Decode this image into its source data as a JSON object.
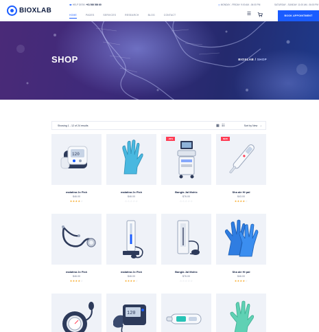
{
  "header": {
    "logo": "BIOXLAB",
    "help_label": "HELP DESK:",
    "help_phone": "+01 500 500 60",
    "address": "MONDAY - FRIDAY: 9:00 AM - 06:00 PM",
    "hours": "SATURDAY - SUNDAY: 11:00 AM - 06:00 PM",
    "nav": [
      "HOME",
      "PAGES",
      "SERVICES",
      "RESEARCH",
      "BLOG",
      "CONTACT"
    ],
    "appointment_label": "BOOK APPOINTMENT"
  },
  "hero": {
    "title": "SHOP",
    "breadcrumb_home": "BIOXLAB",
    "breadcrumb_sep": " / ",
    "breadcrumb_current": "SHOP"
  },
  "toolbar": {
    "result_text": "Showing 1 - 12 of 24 results",
    "sort_label": "Sort by New"
  },
  "colors": {
    "accent": "#1a5cff",
    "badge": "#ff3b53",
    "star": "#f5a623"
  },
  "products": [
    {
      "name": "malatina 2x Fish",
      "price": "$46.00",
      "rating": 4,
      "badge": "",
      "icon": "blood-pressure-monitor-icon"
    },
    {
      "name": "malatina 2x Fish",
      "price": "$46.00",
      "rating": 0,
      "badge": "",
      "icon": "medical-glove-icon"
    },
    {
      "name": "Bangla Jal Mohic",
      "price": "$76.00",
      "rating": 0,
      "badge": "-30%",
      "icon": "ultrasound-machine-icon"
    },
    {
      "name": "Sha ale Hi pal",
      "price": "$43.00",
      "rating": 4,
      "badge": "NEW",
      "icon": "thermometer-icon"
    },
    {
      "name": "malatina 2x Fish",
      "price": "$46.00",
      "rating": 4,
      "badge": "",
      "icon": "stethoscope-icon"
    },
    {
      "name": "malatina 2x Fish",
      "price": "$46.00",
      "rating": 4,
      "badge": "",
      "icon": "sphygmomanometer-icon"
    },
    {
      "name": "Bangla Jal Mohic",
      "price": "$76.00",
      "rating": 0,
      "badge": "",
      "icon": "wall-bp-monitor-icon"
    },
    {
      "name": "Sha ale Hi pal",
      "price": "$46.00",
      "rating": 4,
      "badge": "",
      "icon": "blue-gloves-icon"
    },
    {
      "name": "",
      "price": "",
      "rating": 0,
      "badge": "",
      "icon": "bp-cuff-icon"
    },
    {
      "name": "",
      "price": "",
      "rating": 0,
      "badge": "",
      "icon": "digital-bp-monitor-icon"
    },
    {
      "name": "",
      "price": "",
      "rating": 0,
      "badge": "",
      "icon": "inhaler-device-icon"
    },
    {
      "name": "",
      "price": "",
      "rating": 0,
      "badge": "",
      "icon": "green-glove-icon"
    }
  ]
}
